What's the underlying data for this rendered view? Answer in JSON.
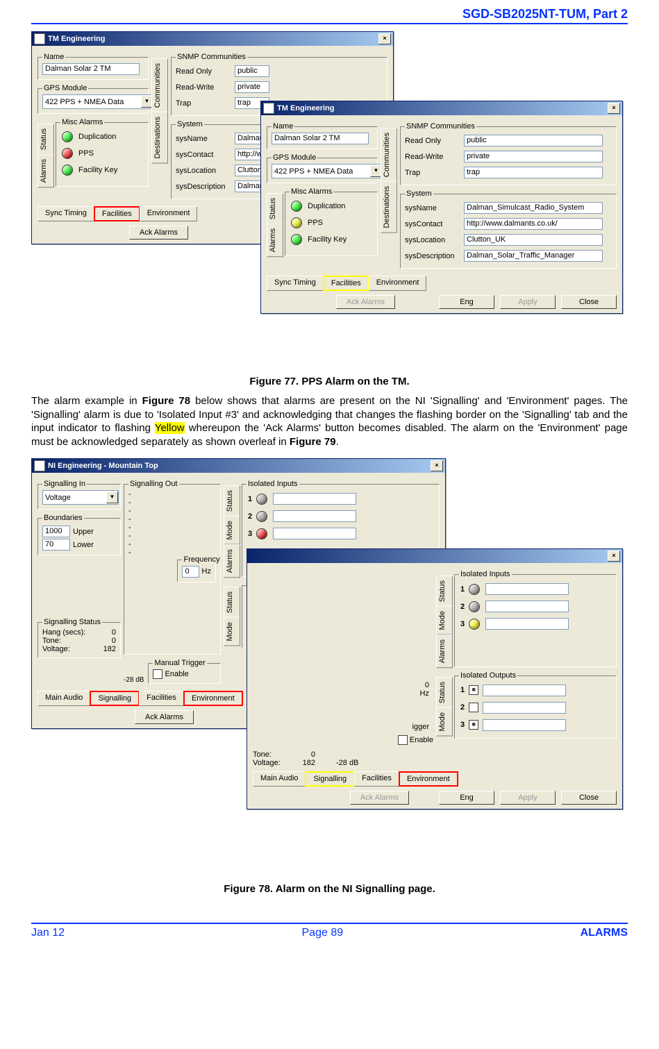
{
  "header": "SGD-SB2025NT-TUM, Part 2",
  "fig77": {
    "caption": "Figure 77.  PPS Alarm on the TM."
  },
  "fig78": {
    "caption": "Figure 78.  Alarm on the NI Signalling page."
  },
  "para": {
    "t1": "The alarm example in ",
    "b1": "Figure 78",
    "t2": " below shows that alarms are present on the NI 'Signalling' and 'Environment' pages.  The 'Signalling' alarm is due to 'Isolated Input #3' and acknowledging that changes the flashing border on the 'Signalling' tab and the input indicator to flashing ",
    "hl": "Yellow",
    "t3": " whereupon the 'Ack Alarms' button becomes disabled.  The alarm on the 'Environment' page must be acknowledged separately as shown overleaf in ",
    "b2": "Figure 79",
    "t4": "."
  },
  "tm": {
    "title": "TM Engineering",
    "name_lbl": "Name",
    "name_val": "Dalman Solar 2 TM",
    "gps_lbl": "GPS Module",
    "gps_val": "422 PPS + NMEA Data",
    "misc_lbl": "Misc Alarms",
    "dup": "Duplication",
    "pps": "PPS",
    "fk": "Facility Key",
    "snmp_lbl": "SNMP Communities",
    "ro": "Read Only",
    "ro_v": "public",
    "rw": "Read-Write",
    "rw_v": "private",
    "tr": "Trap",
    "tr_v": "trap",
    "sys_lbl": "System",
    "sn": "sysName",
    "sn_v_trunc": "Dalman",
    "sn_v": "Dalman_Simulcast_Radio_System",
    "sc": "sysContact",
    "sc_v_trunc": "http://w",
    "sc_v": "http://www.dalmants.co.uk/",
    "sl": "sysLocation",
    "sl_v_trunc": "Clutton_",
    "sl_v": "Clutton_UK",
    "sd": "sysDescription",
    "sd_v_trunc": "Dalman",
    "sd_v": "Dalman_Solar_Traffic_Manager",
    "vt": [
      "Communities",
      "Destinations"
    ],
    "vt2": [
      "Status",
      "Alarms"
    ],
    "ht": [
      "Sync Timing",
      "Facilities",
      "Environment"
    ],
    "ack": "Ack Alarms",
    "eng": "Eng",
    "apply": "Apply",
    "close": "Close"
  },
  "ni": {
    "title": "NI Engineering - Mountain Top",
    "sigin": "Signalling In",
    "voltage": "Voltage",
    "bounds": "Boundaries",
    "upper": "Upper",
    "upper_v": "1000",
    "lower": "Lower",
    "lower_v": "70",
    "sigout": "Signalling Out",
    "dash": "-",
    "sigstat": "Signalling Status",
    "hang": "Hang (secs):",
    "hang_v": "0",
    "tone": "Tone:",
    "tone_v": "0",
    "volt": "Voltage:",
    "volt_v": "182",
    "db": "-28 dB",
    "freq": "Frequency",
    "freq_v": "0",
    "hz": "Hz",
    "mtrig": "Manual Trigger",
    "enable": "Enable",
    "isoin": "Isolated Inputs",
    "isoout": "Isolated Outputs",
    "vt_r": [
      "Status",
      "Mode",
      "Alarms"
    ],
    "vt_r2": [
      "Status",
      "Mode"
    ],
    "ht": [
      "Main Audio",
      "Signalling",
      "Facilities",
      "Environment"
    ],
    "ack": "Ack Alarms",
    "eng": "Eng",
    "apply": "Apply",
    "close": "Close"
  },
  "footer": {
    "left": "Jan 12",
    "mid": "Page 89",
    "right": "ALARMS"
  }
}
